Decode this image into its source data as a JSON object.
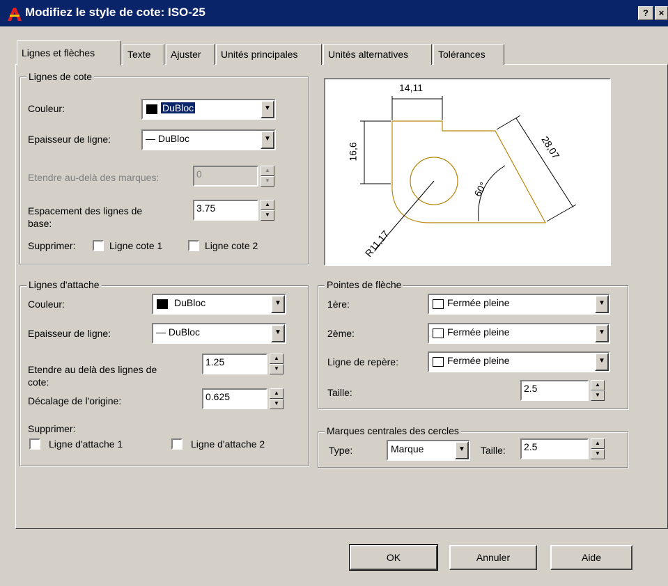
{
  "window": {
    "title": "Modifiez le style de cote: ISO-25",
    "help_button": "?",
    "close_button": "×"
  },
  "tabs": [
    {
      "label": "Lignes et flèches",
      "active": true
    },
    {
      "label": "Texte"
    },
    {
      "label": "Ajuster"
    },
    {
      "label": "Unités principales"
    },
    {
      "label": "Unités alternatives"
    },
    {
      "label": "Tolérances"
    }
  ],
  "dim_lines": {
    "legend": "Lignes de cote",
    "color_label": "Couleur:",
    "color_value": "DuBloc",
    "lineweight_label": "Epaisseur de ligne:",
    "lineweight_value": "— DuBloc",
    "extend_label": "Etendre au-delà des marques:",
    "extend_value": "0",
    "baseline_label_1": "Espacement des lignes de",
    "baseline_label_2": "base:",
    "baseline_value": "3.75",
    "suppress_label": "Supprimer:",
    "suppress_1": "Ligne cote 1",
    "suppress_2": "Ligne cote 2"
  },
  "ext_lines": {
    "legend": "Lignes d'attache",
    "color_label": "Couleur:",
    "color_value": "DuBloc",
    "lineweight_label": "Epaisseur de ligne:",
    "lineweight_value": "— DuBloc",
    "extend_label_1": "Etendre au delà des lignes de",
    "extend_label_2": "cote:",
    "extend_value": "1.25",
    "offset_label": "Décalage de l'origine:",
    "offset_value": "0.625",
    "suppress_label": "Supprimer:",
    "suppress_1": "Ligne d'attache 1",
    "suppress_2": "Ligne d'attache 2"
  },
  "arrowheads": {
    "legend": "Pointes de flèche",
    "first_label": "1ère:",
    "first_value": "Fermée pleine",
    "second_label": "2ème:",
    "second_value": "Fermée pleine",
    "leader_label": "Ligne de repère:",
    "leader_value": "Fermée pleine",
    "size_label": "Taille:",
    "size_value": "2.5"
  },
  "center_marks": {
    "legend": "Marques centrales des cercles",
    "type_label": "Type:",
    "type_value": "Marque",
    "size_label": "Taille:",
    "size_value": "2.5"
  },
  "preview": {
    "dim_top": "14,11",
    "dim_left": "16,6",
    "dim_right": "28,07",
    "dim_angle": "60°",
    "dim_radius": "R11,17"
  },
  "buttons": {
    "ok": "OK",
    "cancel": "Annuler",
    "help": "Aide"
  },
  "colors": {
    "titlebar": "#0a246a",
    "dialog": "#d4d0c8",
    "preview_shape": "#b8860b"
  }
}
